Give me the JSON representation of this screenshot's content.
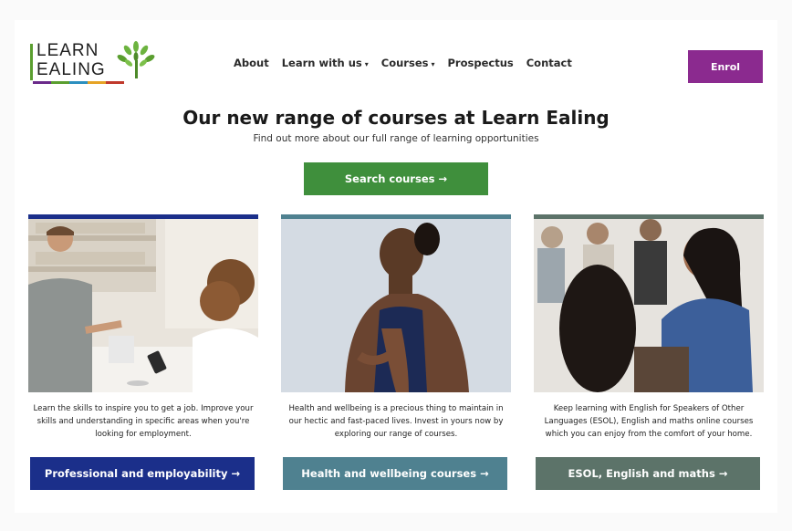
{
  "header": {
    "logo_line1": "LEARN",
    "logo_line2": "EALING",
    "nav": [
      {
        "label": "About",
        "has_dropdown": false
      },
      {
        "label": "Learn with us",
        "has_dropdown": true
      },
      {
        "label": "Courses",
        "has_dropdown": true
      },
      {
        "label": "Prospectus",
        "has_dropdown": false
      },
      {
        "label": "Contact",
        "has_dropdown": false
      }
    ],
    "enrol_label": "Enrol"
  },
  "hero": {
    "title": "Our new range of courses at Learn Ealing",
    "subtitle": "Find out more about our full range of learning opportunities",
    "search_label": "Search courses →"
  },
  "cards": [
    {
      "description": "Learn the skills to inspire you to get a job. Improve your skills and understanding in specific areas when you're looking for employment.",
      "cta": "Professional and employability →",
      "color": "#1b2f8a"
    },
    {
      "description": "Health and wellbeing is a precious thing to maintain in our hectic and fast-paced lives. Invest in yours now by exploring our range of courses.",
      "cta": "Health and wellbeing courses →",
      "color": "#4f8190"
    },
    {
      "description": "Keep learning with English for Speakers of Other Languages (ESOL), English and maths online courses which you can enjoy from the comfort of your home.",
      "cta": "ESOL, English and maths →",
      "color": "#5c7369"
    }
  ],
  "colors": {
    "enrol": "#8b2a8f",
    "search": "#3f8f3c",
    "logo_green": "#5a9e2f"
  }
}
